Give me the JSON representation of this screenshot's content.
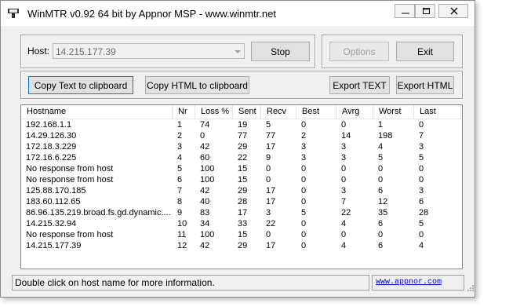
{
  "window": {
    "title": "WinMTR v0.92 64 bit by Appnor MSP - www.winmtr.net"
  },
  "controls": {
    "host_label": "Host:",
    "host_value": "14.215.177.39",
    "stop_label": "Stop",
    "options_label": "Options",
    "exit_label": "Exit",
    "copy_text_label": "Copy Text to clipboard",
    "copy_html_label": "Copy HTML to clipboard",
    "export_text_label": "Export TEXT",
    "export_html_label": "Export HTML"
  },
  "table": {
    "columns": [
      "Hostname",
      "Nr",
      "Loss %",
      "Sent",
      "Recv",
      "Best",
      "Avrg",
      "Worst",
      "Last"
    ],
    "rows": [
      [
        "192.168.1.1",
        "1",
        "74",
        "19",
        "5",
        "0",
        "0",
        "1",
        "0"
      ],
      [
        "14.29.126.30",
        "2",
        "0",
        "77",
        "77",
        "2",
        "14",
        "198",
        "7"
      ],
      [
        "172.18.3.229",
        "3",
        "42",
        "29",
        "17",
        "3",
        "3",
        "4",
        "3"
      ],
      [
        "172.16.6.225",
        "4",
        "60",
        "22",
        "9",
        "3",
        "3",
        "5",
        "5"
      ],
      [
        "No response from host",
        "5",
        "100",
        "15",
        "0",
        "0",
        "0",
        "0",
        "0"
      ],
      [
        "No response from host",
        "6",
        "100",
        "15",
        "0",
        "0",
        "0",
        "0",
        "0"
      ],
      [
        "125.88.170.185",
        "7",
        "42",
        "29",
        "17",
        "0",
        "3",
        "6",
        "3"
      ],
      [
        "183.60.112.65",
        "8",
        "40",
        "28",
        "17",
        "0",
        "7",
        "12",
        "6"
      ],
      [
        "86.96.135.219.broad.fs.gd.dynamic....",
        "9",
        "83",
        "17",
        "3",
        "5",
        "22",
        "35",
        "28"
      ],
      [
        "14.215.32.94",
        "10",
        "34",
        "33",
        "22",
        "0",
        "4",
        "6",
        "5"
      ],
      [
        "No response from host",
        "11",
        "100",
        "15",
        "0",
        "0",
        "0",
        "0",
        "0"
      ],
      [
        "14.215.177.39",
        "12",
        "42",
        "29",
        "17",
        "0",
        "4",
        "6",
        "4"
      ]
    ]
  },
  "status": {
    "message": "Double click on host name for more information.",
    "link": "www.appnor.com"
  }
}
